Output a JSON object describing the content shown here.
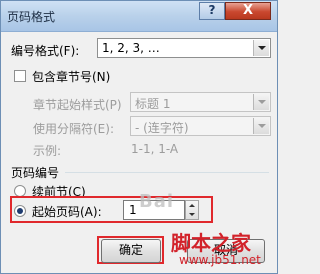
{
  "window": {
    "title": "页码格式",
    "help_glyph": "?",
    "close_glyph": "X"
  },
  "number_format": {
    "label": "编号格式(F):",
    "value": "1, 2, 3, …"
  },
  "chapter": {
    "checkbox_label": "包含章节号(N)",
    "style_label": "章节起始样式(P)",
    "style_value": "标题 1",
    "separator_label": "使用分隔符(E):",
    "separator_value": "-  (连字符)",
    "example_label": "示例:",
    "example_value": "1-1, 1-A"
  },
  "numbering": {
    "group_label": "页码编号",
    "continue_label": "续前节(C)",
    "start_label": "起始页码(A):",
    "start_value": "1"
  },
  "buttons": {
    "ok": "确定",
    "cancel": "取消"
  },
  "watermark": {
    "text1": "Bai",
    "text2": "脚本之家",
    "text3": "www.jb51.net"
  }
}
